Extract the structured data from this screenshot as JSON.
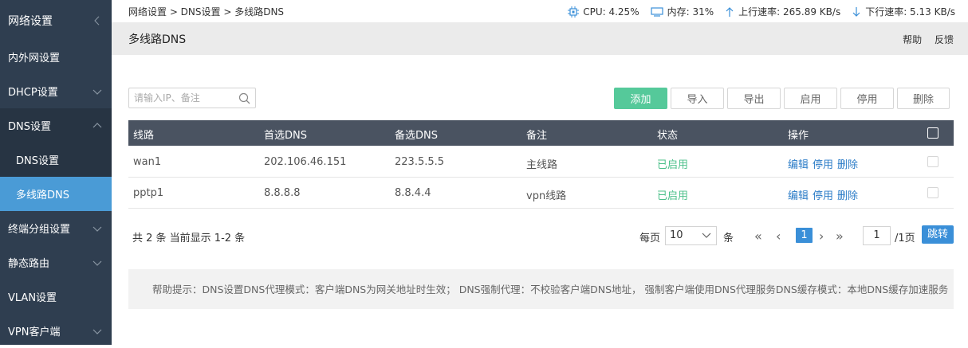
{
  "sidebar": {
    "items": [
      {
        "label": "网络设置"
      },
      {
        "label": "内外网设置"
      },
      {
        "label": "DHCP设置"
      },
      {
        "label": "DNS设置"
      },
      {
        "label": "DNS设置"
      },
      {
        "label": "多线路DNS"
      },
      {
        "label": "终端分组设置"
      },
      {
        "label": "静态路由"
      },
      {
        "label": "VLAN设置"
      },
      {
        "label": "VPN客户端"
      }
    ]
  },
  "breadcrumb": "网络设置 > DNS设置 > 多线路DNS",
  "stats": {
    "cpu": "CPU: 4.25%",
    "mem": "内存: 31%",
    "up": "上行速率: 265.89 KB/s",
    "down": "下行速率: 5.13 KB/s"
  },
  "header": {
    "title": "多线路DNS",
    "help": "帮助",
    "feedback": "反馈"
  },
  "search": {
    "placeholder": "请输入IP、备注"
  },
  "toolbar": {
    "add": "添加",
    "import": "导入",
    "export": "导出",
    "enable": "启用",
    "disable": "停用",
    "delete": "删除"
  },
  "table": {
    "headers": [
      "线路",
      "首选DNS",
      "备选DNS",
      "备注",
      "状态",
      "操作"
    ],
    "rows": [
      {
        "line": "wan1",
        "primary": "202.106.46.151",
        "secondary": "223.5.5.5",
        "note": "主线路",
        "status": "已启用",
        "edit": "编辑",
        "disable": "停用",
        "delete": "删除"
      },
      {
        "line": "pptp1",
        "primary": "8.8.8.8",
        "secondary": "8.8.4.4",
        "note": "vpn线路",
        "status": "已启用",
        "edit": "编辑",
        "disable": "停用",
        "delete": "删除"
      }
    ]
  },
  "pagination": {
    "summary": "共 2 条 当前显示 1-2 条",
    "per_page_label": "每页",
    "per_page": "10",
    "unit": "条",
    "first": "«",
    "prev": "‹",
    "current": "1",
    "next": "›",
    "last": "»",
    "page_input": "1",
    "total_pages": "/1页",
    "go": "跳转"
  },
  "help_text": "帮助提示：DNS设置DNS代理模式：客户端DNS为网关地址时生效；  DNS强制代理：不校验客户端DNS地址， 强制客户端使用DNS代理服务DNS缓存模式：本地DNS缓存加速服务"
}
